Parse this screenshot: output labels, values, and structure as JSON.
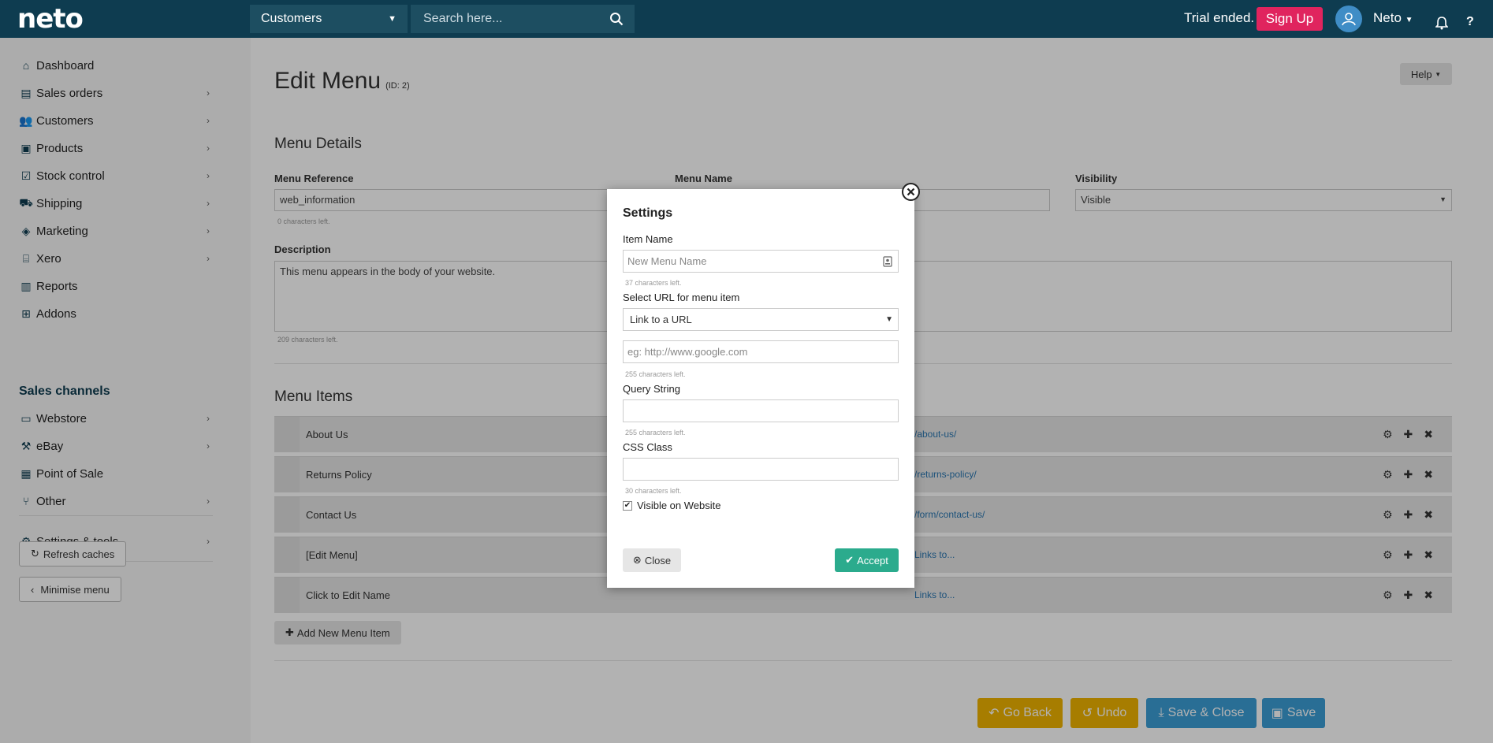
{
  "topbar": {
    "logo": "neto",
    "channel": "Customers",
    "search_placeholder": "Search here...",
    "trial_text": "Trial ended.",
    "signup_label": "Sign Up",
    "user_name": "Neto"
  },
  "sidebar": {
    "items": [
      {
        "label": "Dashboard"
      },
      {
        "label": "Sales orders"
      },
      {
        "label": "Customers"
      },
      {
        "label": "Products"
      },
      {
        "label": "Stock control"
      },
      {
        "label": "Shipping"
      },
      {
        "label": "Marketing"
      },
      {
        "label": "Xero"
      },
      {
        "label": "Reports"
      },
      {
        "label": "Addons"
      }
    ],
    "channels_heading": "Sales channels",
    "channels": [
      {
        "label": "Webstore"
      },
      {
        "label": "eBay"
      },
      {
        "label": "Point of Sale"
      },
      {
        "label": "Other"
      }
    ],
    "settings_label": "Settings & tools",
    "refresh_label": "Refresh caches",
    "minimise_label": "Minimise menu"
  },
  "page": {
    "title": "Edit Menu",
    "id_label": "(ID: 2)",
    "help_label": "Help",
    "details_title": "Menu Details",
    "ref_label": "Menu Reference",
    "ref_value": "web_information",
    "ref_hint": "0 characters left.",
    "name_label": "Menu Name",
    "visibility_label": "Visibility",
    "visibility_value": "Visible",
    "desc_label": "Description",
    "desc_value": "This menu appears in the body of your website.",
    "desc_hint": "209 characters left.",
    "items_title": "Menu Items",
    "menu_items": [
      {
        "label": "About Us",
        "link": "/about-us/"
      },
      {
        "label": "Returns Policy",
        "link": "/returns-policy/"
      },
      {
        "label": "Contact Us",
        "link": "/form/contact-us/"
      },
      {
        "label": "[Edit Menu]",
        "link": "Links to..."
      },
      {
        "label": "Click to Edit Name",
        "link": "Links to..."
      }
    ],
    "add_item_label": "Add New Menu Item",
    "buttons": {
      "go_back": "Go Back",
      "undo": "Undo",
      "save_close": "Save & Close",
      "save": "Save"
    }
  },
  "modal": {
    "title": "Settings",
    "item_name_label": "Item Name",
    "item_name_placeholder": "New Menu Name",
    "item_name_hint": "37 characters left.",
    "url_label": "Select URL for menu item",
    "url_select_value": "Link to a URL",
    "url_placeholder": "eg: http://www.google.com",
    "url_hint": "255 characters left.",
    "query_label": "Query String",
    "query_hint": "255 characters left.",
    "css_label": "CSS Class",
    "css_hint": "30 characters left.",
    "visible_label": "Visible on Website",
    "close_label": "Close",
    "accept_label": "Accept"
  },
  "colors": {
    "topbar": "#0e3c50",
    "signup": "#e0245e",
    "accept": "#2bab8d",
    "go_back": "#f0b400",
    "save": "#3b9ed6"
  }
}
